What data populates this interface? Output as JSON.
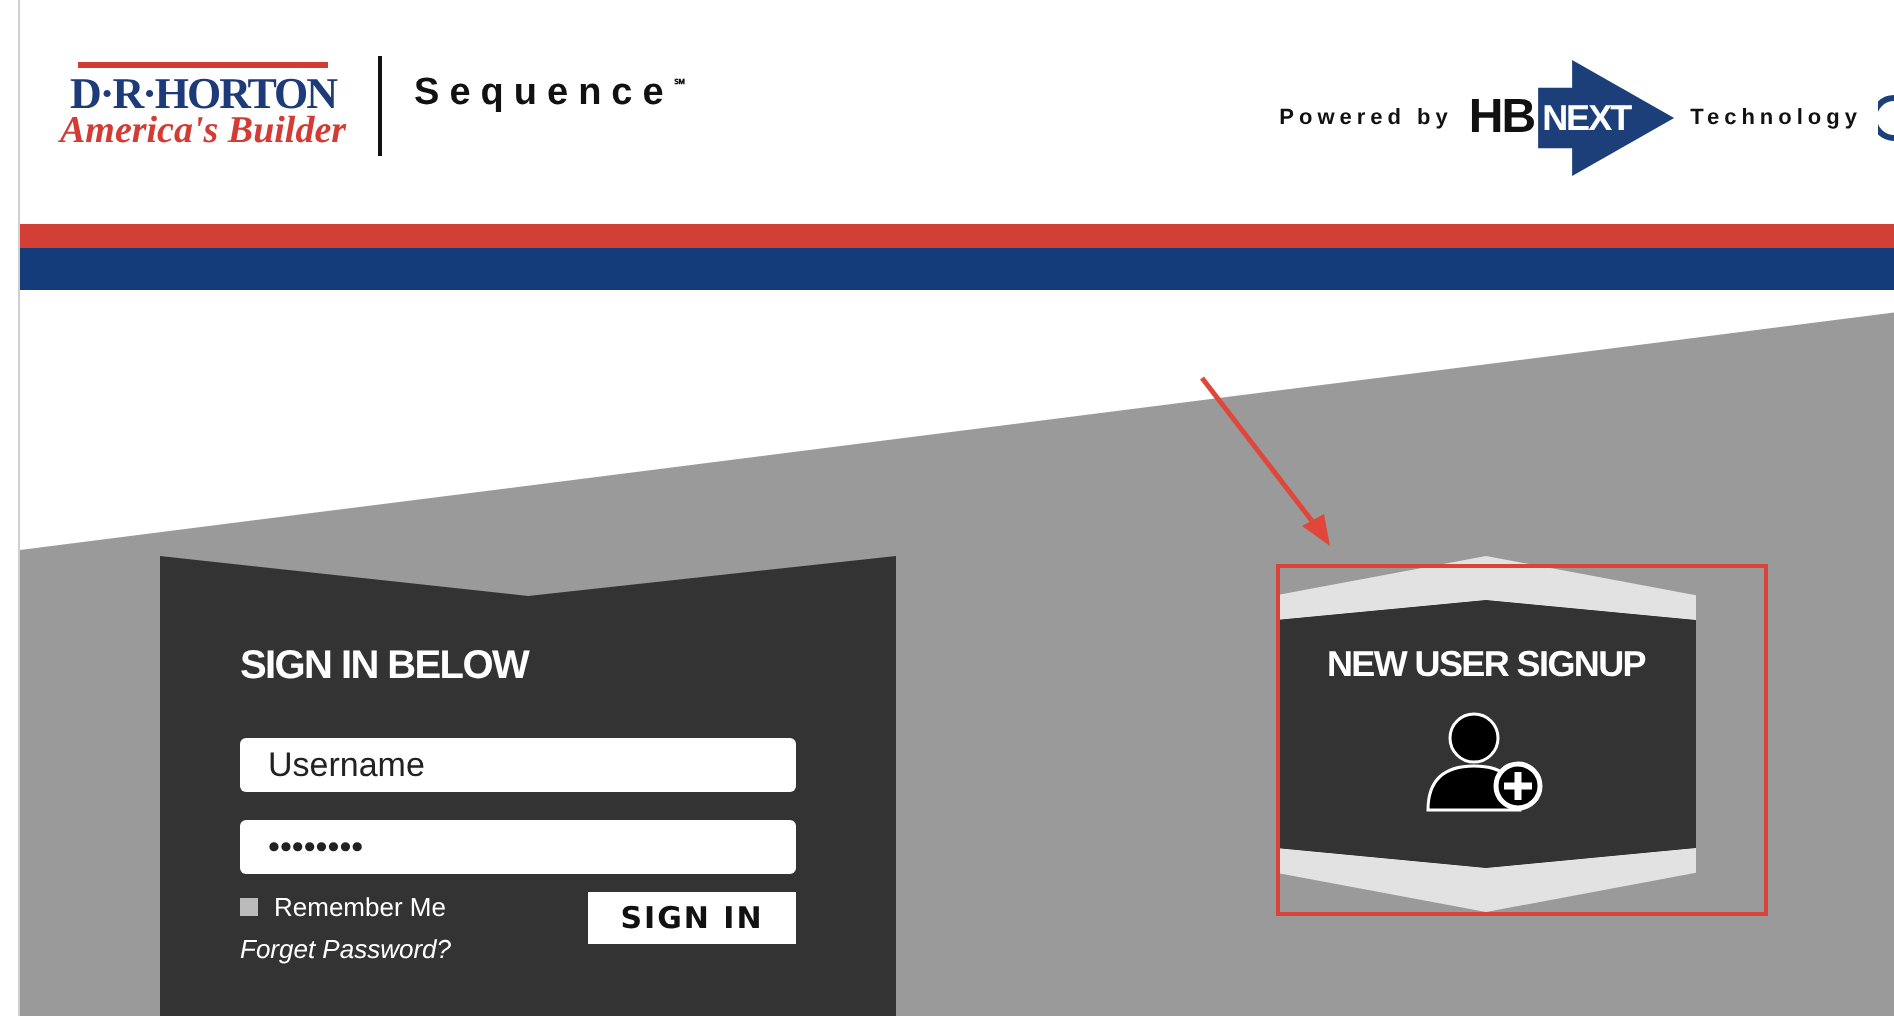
{
  "header": {
    "logo_name": "D·R·HORTON",
    "logo_tagline": "America's Builder",
    "product": "Sequence",
    "product_mark": "℠",
    "powered_prefix": "Powered by",
    "partner_logo_a": "HB",
    "partner_logo_b": "NEXT",
    "powered_suffix": "Technology"
  },
  "signin": {
    "title": "SIGN IN BELOW",
    "username": {
      "placeholder": "Username"
    },
    "password": {
      "value": "••••••••"
    },
    "remember": {
      "label": "Remember Me",
      "checked": false
    },
    "sign_in_button": "SIGN IN",
    "forgot_link": "Forget Password?"
  },
  "signup": {
    "title": "NEW USER SIGNUP"
  }
}
